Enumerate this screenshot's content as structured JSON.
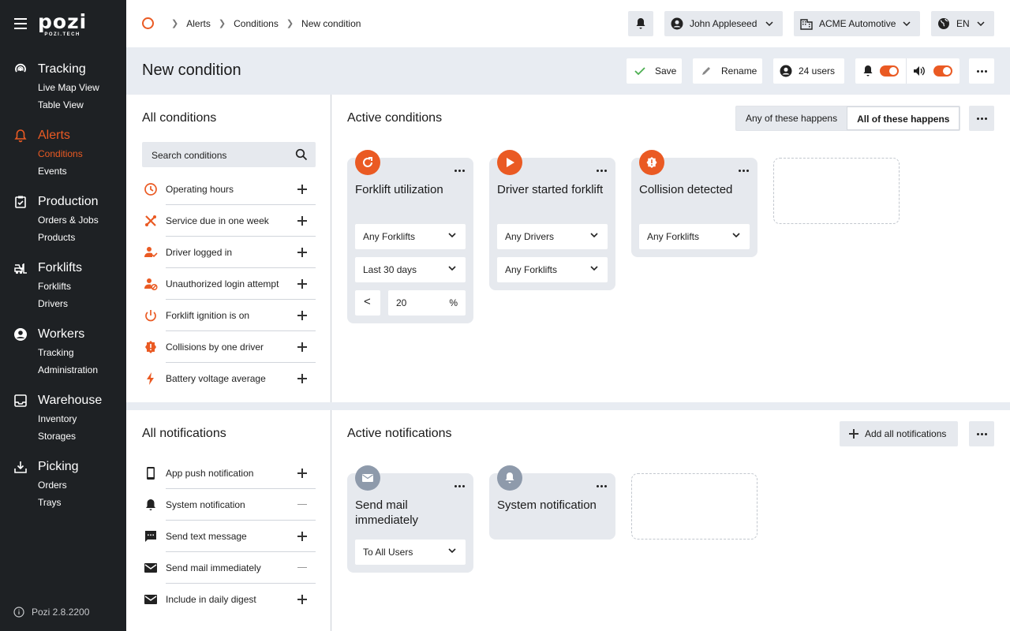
{
  "app": {
    "logo": "pozi",
    "logo_sub": "POZI.TECH",
    "version": "Pozi 2.8.2200"
  },
  "sidebar": {
    "sections": [
      {
        "title": "Tracking",
        "icon": "tracking-icon",
        "items": [
          "Live Map View",
          "Table View"
        ]
      },
      {
        "title": "Alerts",
        "icon": "bell-icon",
        "items": [
          "Conditions",
          "Events"
        ],
        "active": true
      },
      {
        "title": "Production",
        "icon": "clipboard-icon",
        "items": [
          "Orders & Jobs",
          "Products"
        ]
      },
      {
        "title": "Forklifts",
        "icon": "forklift-icon",
        "items": [
          "Forklifts",
          "Drivers"
        ]
      },
      {
        "title": "Workers",
        "icon": "user-circle-icon",
        "items": [
          "Tracking",
          "Administration"
        ]
      },
      {
        "title": "Warehouse",
        "icon": "inbox-icon",
        "items": [
          "Inventory",
          "Storages"
        ]
      },
      {
        "title": "Picking",
        "icon": "download-tray-icon",
        "items": [
          "Orders",
          "Trays"
        ]
      }
    ]
  },
  "topbar": {
    "breadcrumb": [
      "Alerts",
      "Conditions",
      "New condition"
    ],
    "user": "John Appleseed",
    "company": "ACME Automotive",
    "language": "EN"
  },
  "header": {
    "title": "New condition",
    "save": "Save",
    "rename": "Rename",
    "users": "24 users"
  },
  "conditions": {
    "title": "All conditions",
    "search_placeholder": "Search conditions",
    "items": [
      {
        "label": "Operating hours",
        "icon": "clock-icon"
      },
      {
        "label": "Service due in one week",
        "icon": "tools-icon"
      },
      {
        "label": "Driver logged in",
        "icon": "driver-icon"
      },
      {
        "label": "Unauthorized login attempt",
        "icon": "user-lock-icon"
      },
      {
        "label": "Forklift ignition is on",
        "icon": "power-icon"
      },
      {
        "label": "Collisions by one driver",
        "icon": "alert-badge-icon"
      },
      {
        "label": "Battery voltage average",
        "icon": "bolt-icon"
      }
    ]
  },
  "active_conditions": {
    "title": "Active conditions",
    "mode_any": "Any of these happens",
    "mode_all": "All of these happens",
    "selected_mode": "All of these happens",
    "cards": [
      {
        "title": "Forklift utilization",
        "icon": "refresh-icon",
        "dropdowns": [
          "Any Forklifts",
          "Last 30 days"
        ],
        "operator": "<",
        "value": "20",
        "unit": "%"
      },
      {
        "title": "Driver started forklift",
        "icon": "play-icon",
        "dropdowns": [
          "Any Drivers",
          "Any Forklifts"
        ]
      },
      {
        "title": "Collision detected",
        "icon": "alert-badge-icon",
        "dropdowns": [
          "Any Forklifts"
        ]
      }
    ]
  },
  "notifications": {
    "title": "All notifications",
    "items": [
      {
        "label": "App push notification",
        "icon": "phone-icon",
        "state": "add"
      },
      {
        "label": "System notification",
        "icon": "bell-icon",
        "state": "added"
      },
      {
        "label": "Send text message",
        "icon": "message-icon",
        "state": "add"
      },
      {
        "label": "Send mail immediately",
        "icon": "mail-icon",
        "state": "added"
      },
      {
        "label": "Include in daily digest",
        "icon": "mail-icon",
        "state": "add"
      }
    ]
  },
  "active_notifications": {
    "title": "Active notifications",
    "add_all": "Add all notifications",
    "cards": [
      {
        "title": "Send mail immediately",
        "icon": "mail-icon",
        "dropdowns": [
          "To All Users"
        ]
      },
      {
        "title": "System notification",
        "icon": "bell-icon"
      }
    ]
  },
  "colors": {
    "accent": "#ea5a23",
    "sidebar": "#1e2124",
    "panel": "#e8ecf2",
    "card": "#e6e9ee"
  }
}
